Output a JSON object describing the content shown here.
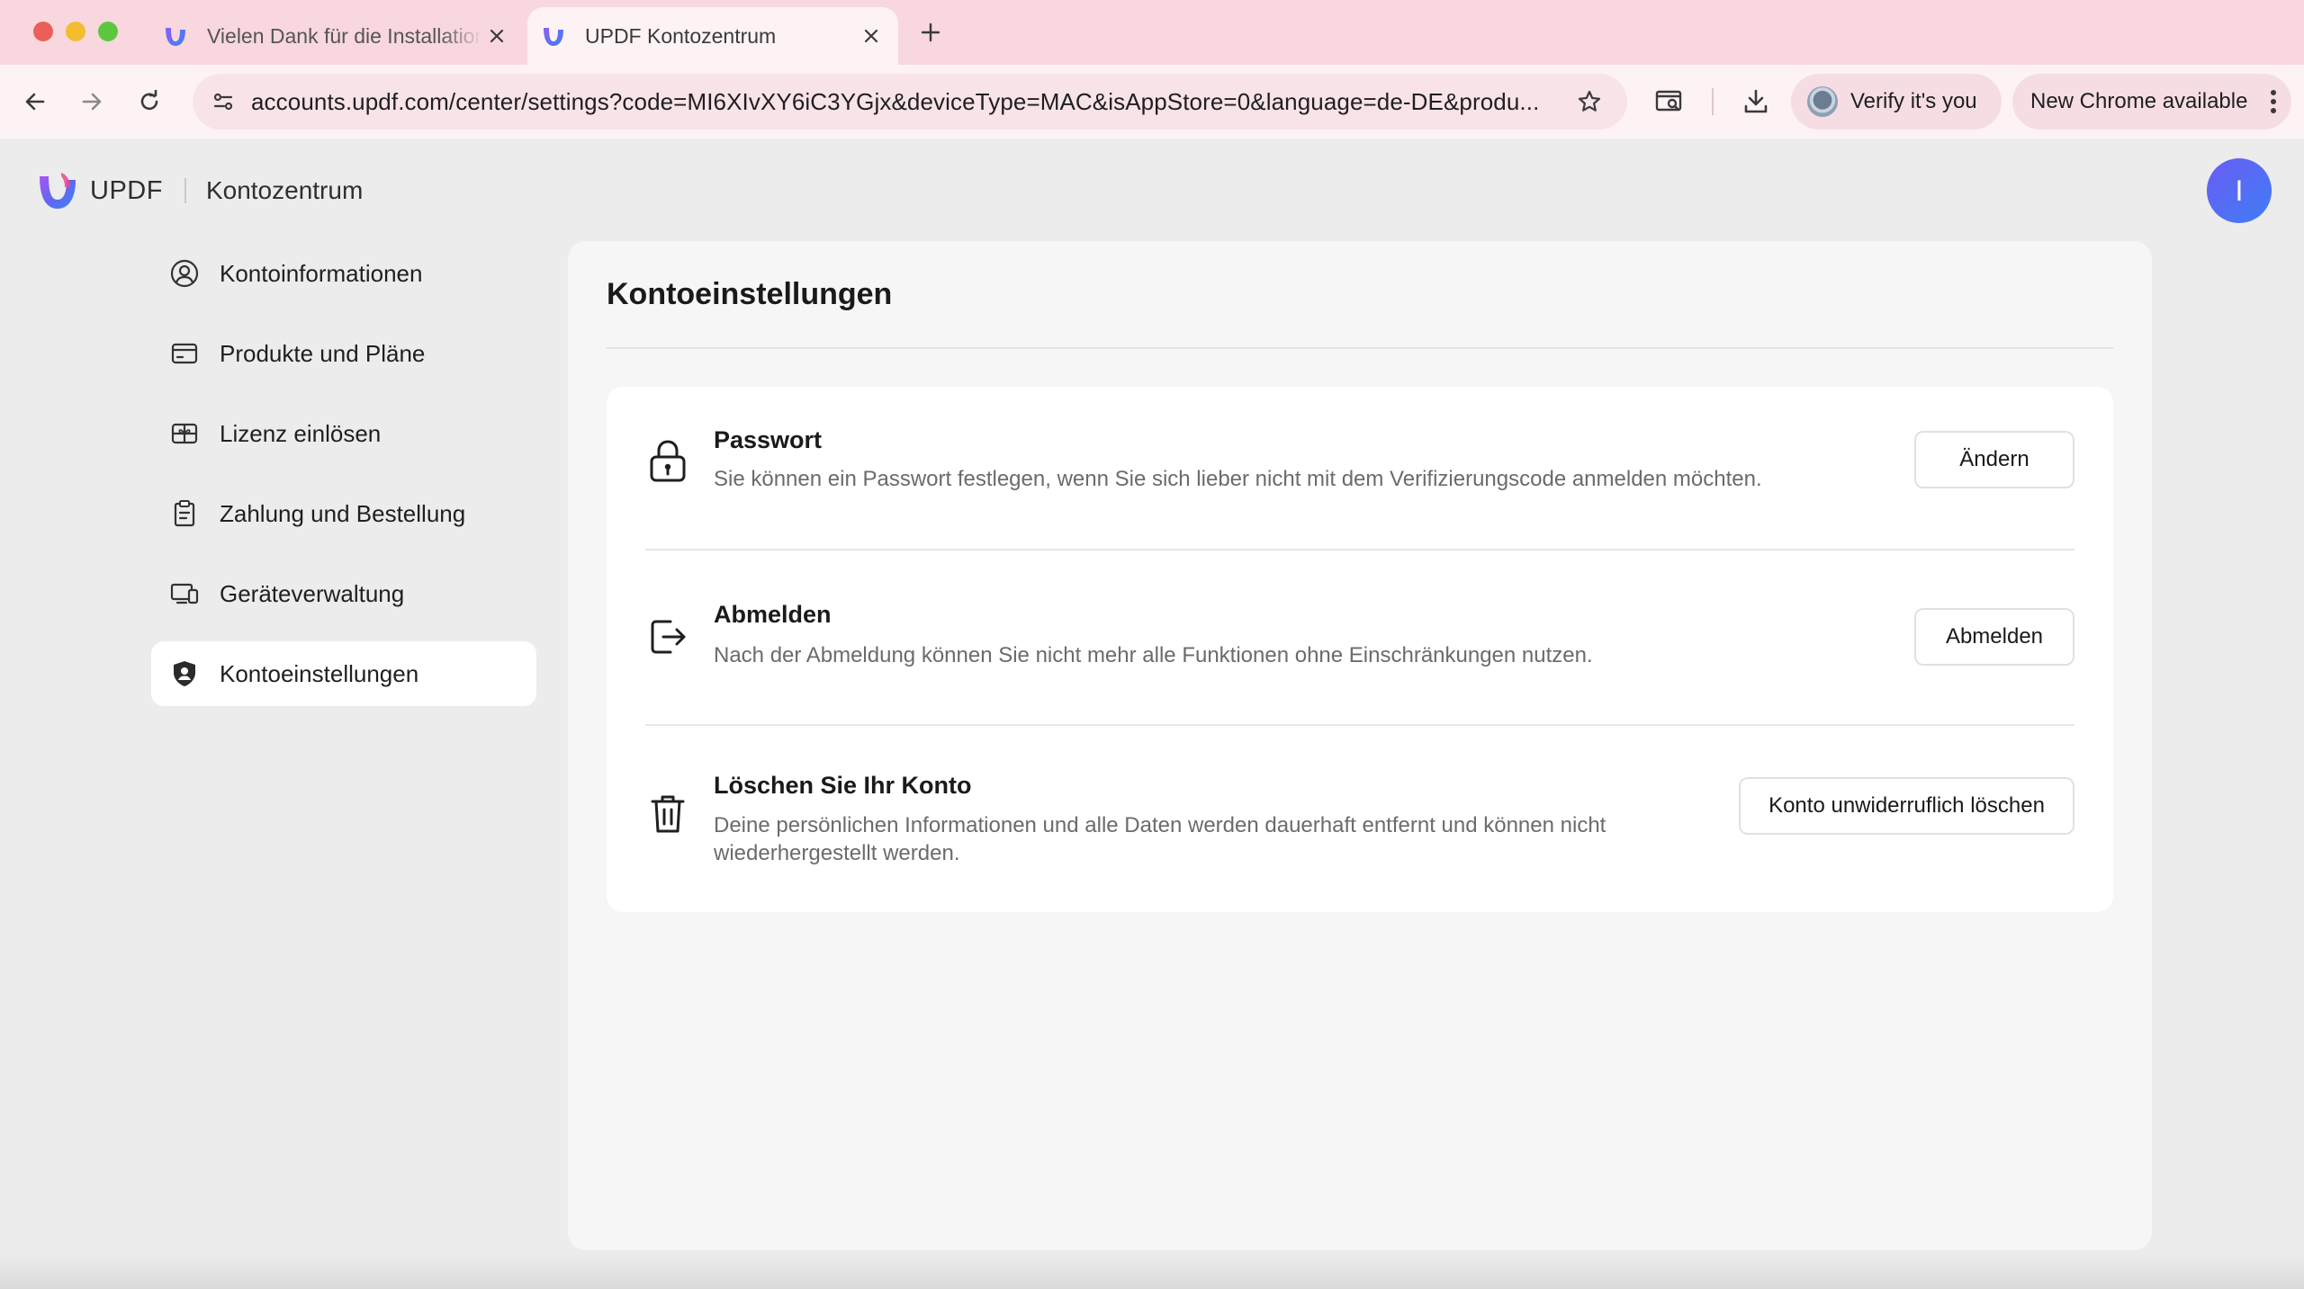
{
  "browser": {
    "tabs": [
      {
        "title": "Vielen Dank für die Installation",
        "active": false
      },
      {
        "title": "UPDF Kontozentrum",
        "active": true
      }
    ],
    "url": "accounts.updf.com/center/settings?code=MI6XIvXY6iC3YGjx&deviceType=MAC&isAppStore=0&language=de-DE&produ...",
    "verify_label": "Verify it's you",
    "update_label": "New Chrome available"
  },
  "brand": {
    "name": "UPDF",
    "section": "Kontozentrum",
    "avatar_initial": "I",
    "accent_color": "#4f63f0"
  },
  "sidebar": {
    "items": [
      {
        "label": "Kontoinformationen",
        "icon": "user-circle-icon",
        "active": false
      },
      {
        "label": "Produkte und Pläne",
        "icon": "credit-card-icon",
        "active": false
      },
      {
        "label": "Lizenz einlösen",
        "icon": "gift-card-icon",
        "active": false
      },
      {
        "label": "Zahlung und Bestellung",
        "icon": "clipboard-icon",
        "active": false
      },
      {
        "label": "Geräteverwaltung",
        "icon": "devices-icon",
        "active": false
      },
      {
        "label": "Kontoeinstellungen",
        "icon": "shield-user-icon",
        "active": true
      }
    ]
  },
  "main": {
    "title": "Kontoeinstellungen",
    "settings": [
      {
        "title": "Passwort",
        "description": "Sie können ein Passwort festlegen, wenn Sie sich lieber nicht mit dem Verifizierungscode anmelden möchten.",
        "button": "Ändern",
        "icon": "lock-icon"
      },
      {
        "title": "Abmelden",
        "description": "Nach der Abmeldung können Sie nicht mehr alle Funktionen ohne Einschränkungen nutzen.",
        "button": "Abmelden",
        "icon": "logout-icon"
      },
      {
        "title": "Löschen Sie Ihr Konto",
        "description": "Deine persönlichen Informationen und alle Daten werden dauerhaft entfernt und können nicht wiederhergestellt werden.",
        "button": "Konto unwiderruflich löschen",
        "icon": "trash-icon"
      }
    ]
  }
}
